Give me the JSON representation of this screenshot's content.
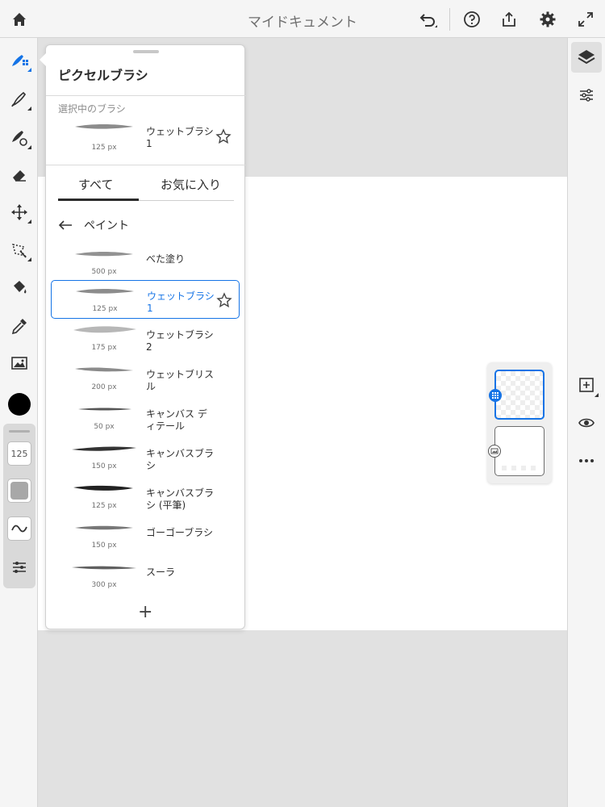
{
  "header": {
    "title": "マイドキュメント"
  },
  "left_tools": {
    "brush_size": "125"
  },
  "popover": {
    "title": "ピクセルブラシ",
    "current_section": "選択中のブラシ",
    "current_brush": {
      "name": "ウェットブラシ 1",
      "size": "125 px"
    },
    "tabs": [
      "すべて",
      "お気に入り"
    ],
    "back_label": "ペイント",
    "brushes": [
      {
        "name": "べた塗り",
        "size": "500 px"
      },
      {
        "name": "ウェットブラシ 1",
        "size": "125 px"
      },
      {
        "name": "ウェットブラシ 2",
        "size": "175 px"
      },
      {
        "name": "ウェットブリスル",
        "size": "200 px"
      },
      {
        "name": "キャンバス ディテール",
        "size": "50 px"
      },
      {
        "name": "キャンバスブラシ",
        "size": "150 px"
      },
      {
        "name": "キャンバスブラシ (平筆)",
        "size": "125 px"
      },
      {
        "name": "ゴーゴーブラシ",
        "size": "150 px"
      },
      {
        "name": "スーラ",
        "size": "300 px"
      }
    ],
    "add_label": "+"
  },
  "colors": {
    "accent": "#1473e6",
    "brush_color": "#000000"
  }
}
